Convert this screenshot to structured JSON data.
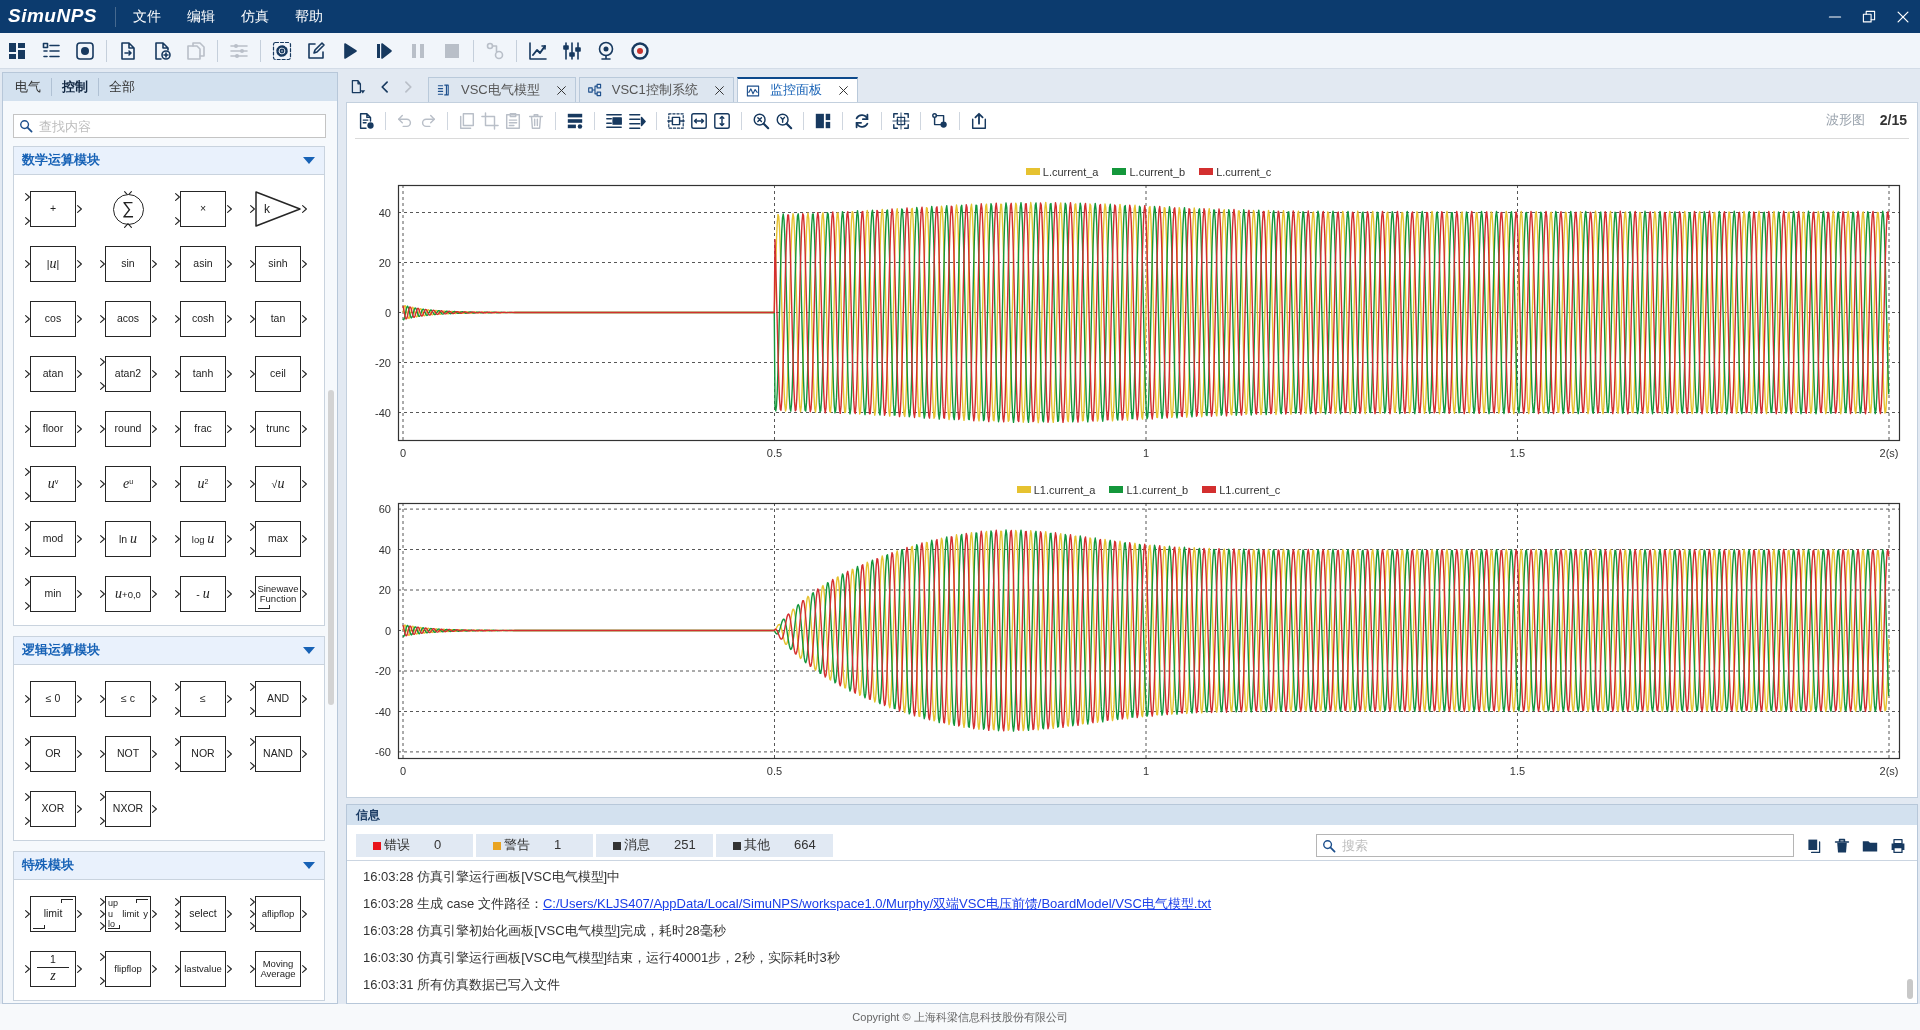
{
  "window": {
    "logo": "SimuNPS",
    "menu": [
      "文件",
      "编辑",
      "仿真",
      "帮助"
    ]
  },
  "toolbar": [
    [
      {
        "kind": "grid",
        "disabled": false
      },
      {
        "kind": "list",
        "disabled": false
      },
      {
        "kind": "screen",
        "disabled": false
      }
    ],
    [
      {
        "kind": "import",
        "disabled": false
      },
      {
        "kind": "add",
        "disabled": false
      },
      {
        "kind": "duplicate",
        "disabled": true
      }
    ],
    [
      {
        "kind": "tune",
        "disabled": true
      }
    ],
    [
      {
        "kind": "gear",
        "disabled": false
      },
      {
        "kind": "edit",
        "disabled": false
      },
      {
        "kind": "play",
        "disabled": false
      },
      {
        "kind": "step",
        "disabled": false
      },
      {
        "kind": "pause",
        "disabled": true
      },
      {
        "kind": "stop",
        "disabled": true
      }
    ],
    [
      {
        "kind": "node",
        "disabled": true
      }
    ],
    [
      {
        "kind": "chart",
        "disabled": false
      },
      {
        "kind": "sliders",
        "disabled": false
      },
      {
        "kind": "pin",
        "disabled": false
      },
      {
        "kind": "target",
        "disabled": false
      }
    ]
  ],
  "library": {
    "tabs": [
      {
        "label": "电气",
        "selected": false
      },
      {
        "label": "控制",
        "selected": true
      },
      {
        "label": "全部",
        "selected": false
      }
    ],
    "search": {
      "placeholder": "查找内容"
    },
    "sections": [
      {
        "title": "数学运算模块",
        "expanded": true,
        "blocks": [
          {
            "label": "+",
            "kind": "binary"
          },
          {
            "label": "∑",
            "kind": "sum"
          },
          {
            "label": "×",
            "kind": "binary"
          },
          {
            "label": "k",
            "kind": "gain"
          },
          {
            "label": "|*u*|",
            "kind": "unary"
          },
          {
            "label": "sin",
            "kind": "unary"
          },
          {
            "label": "asin",
            "kind": "unary"
          },
          {
            "label": "sinh",
            "kind": "unary"
          },
          {
            "label": "cos",
            "kind": "unary"
          },
          {
            "label": "acos",
            "kind": "unary"
          },
          {
            "label": "cosh",
            "kind": "unary"
          },
          {
            "label": "tan",
            "kind": "unary"
          },
          {
            "label": "atan",
            "kind": "unary"
          },
          {
            "label": "atan2",
            "kind": "binary"
          },
          {
            "label": "tanh",
            "kind": "unary"
          },
          {
            "label": "ceil",
            "kind": "unary"
          },
          {
            "label": "floor",
            "kind": "unary"
          },
          {
            "label": "round",
            "kind": "unary"
          },
          {
            "label": "frac",
            "kind": "unary"
          },
          {
            "label": "trunc",
            "kind": "unary"
          },
          {
            "label": "*u*$^{v}$",
            "kind": "binary"
          },
          {
            "label": "*e*$^{u}$",
            "kind": "unary"
          },
          {
            "label": "*u*$^{2}$",
            "kind": "unary"
          },
          {
            "label": "√*u*",
            "kind": "unary"
          },
          {
            "label": "mod",
            "kind": "binary"
          },
          {
            "label": "ln *u*",
            "kind": "unary"
          },
          {
            "label": "log *u*",
            "kind": "unary"
          },
          {
            "label": "max",
            "kind": "binary"
          },
          {
            "label": "min",
            "kind": "binary"
          },
          {
            "label": "*u*+0,0",
            "kind": "unary"
          },
          {
            "label": "- *u*",
            "kind": "unary"
          },
          {
            "label": "Sinewave Function",
            "kind": "wave"
          }
        ]
      },
      {
        "title": "逻辑运算模块",
        "expanded": true,
        "blocks": [
          {
            "label": "≤ 0",
            "kind": "unary"
          },
          {
            "label": "≤ c",
            "kind": "unary"
          },
          {
            "label": "≤",
            "kind": "binary"
          },
          {
            "label": "AND",
            "kind": "binary"
          },
          {
            "label": "OR",
            "kind": "binary"
          },
          {
            "label": "NOT",
            "kind": "unary"
          },
          {
            "label": "NOR",
            "kind": "binary"
          },
          {
            "label": "NAND",
            "kind": "binary"
          },
          {
            "label": "XOR",
            "kind": "binary"
          },
          {
            "label": "NXOR",
            "kind": "binary"
          }
        ]
      },
      {
        "title": "特殊模块",
        "expanded": true,
        "blocks": [
          {
            "label": "limit",
            "kind": "limit"
          },
          {
            "label": "limit",
            "kind": "dynlimit",
            "inputs": [
              "up",
              "u",
              "lo"
            ],
            "output": "y"
          },
          {
            "label": "select",
            "kind": "ternary"
          },
          {
            "label": "aflipflop",
            "kind": "ternary"
          },
          {
            "label": "1",
            "kind": "fraction",
            "denominator": "z"
          },
          {
            "label": "flipflop",
            "kind": "binary"
          },
          {
            "label": "lastvalue",
            "kind": "unary"
          },
          {
            "label": "Moving Average",
            "kind": "unary"
          }
        ]
      }
    ]
  },
  "workspace": {
    "nav": [
      {
        "kind": "menu",
        "disabled": false
      },
      {
        "kind": "back",
        "disabled": false
      },
      {
        "kind": "forward",
        "disabled": true
      }
    ],
    "tabs": [
      {
        "label": "VSC电气模型",
        "kind": "model",
        "selected": false
      },
      {
        "label": "VSC1控制系统",
        "kind": "control",
        "selected": false
      },
      {
        "label": "监控面板",
        "kind": "monitor",
        "selected": true
      }
    ],
    "toolbar": [
      [
        {
          "kind": "new_doc",
          "disabled": false
        }
      ],
      [
        {
          "kind": "undo",
          "disabled": true
        },
        {
          "kind": "redo",
          "disabled": true
        }
      ],
      [
        {
          "kind": "copy",
          "disabled": true
        },
        {
          "kind": "crop",
          "disabled": true
        },
        {
          "kind": "paste",
          "disabled": true
        },
        {
          "kind": "trash",
          "disabled": true
        }
      ],
      [
        {
          "kind": "rows",
          "disabled": false
        }
      ],
      [
        {
          "kind": "lines",
          "disabled": false
        },
        {
          "kind": "indent",
          "disabled": false
        }
      ],
      [
        {
          "kind": "select",
          "disabled": false
        },
        {
          "kind": "fit_width",
          "disabled": false
        },
        {
          "kind": "fit_height",
          "disabled": false
        }
      ],
      [
        {
          "kind": "zoom_x",
          "disabled": false
        },
        {
          "kind": "zoom_y",
          "disabled": false
        }
      ],
      [
        {
          "kind": "split",
          "disabled": false
        }
      ],
      [
        {
          "kind": "refresh",
          "disabled": false
        }
      ],
      [
        {
          "kind": "focus",
          "disabled": false
        }
      ],
      [
        {
          "kind": "branch",
          "disabled": false
        }
      ],
      [
        {
          "kind": "export",
          "disabled": false
        }
      ]
    ],
    "view_label": "波形图",
    "page": "2/15",
    "charts": [
      {
        "kind": "step",
        "series": [
          {
            "name": "L.current_a",
            "color": "#e6c230"
          },
          {
            "name": "L.current_b",
            "color": "#14973b"
          },
          {
            "name": "L.current_c",
            "color": "#d32f2f"
          }
        ],
        "y_tick_labels": [
          "40",
          "20",
          "0",
          "-20",
          "-40"
        ],
        "x_tick_labels": [
          "0",
          "0.5",
          "1",
          "1.5",
          "2(s)"
        ]
      },
      {
        "kind": "swell",
        "series": [
          {
            "name": "L1.current_a",
            "color": "#e6c230"
          },
          {
            "name": "L1.current_b",
            "color": "#14973b"
          },
          {
            "name": "L1.current_c",
            "color": "#d32f2f"
          }
        ],
        "y_tick_labels": [
          "60",
          "40",
          "20",
          "0",
          "-20",
          "-40",
          "-60"
        ],
        "x_tick_labels": [
          "0",
          "0.5",
          "1",
          "1.5",
          "2(s)"
        ]
      }
    ]
  },
  "info": {
    "title": "信息",
    "filters": [
      {
        "label": "错误",
        "count": "0",
        "color": "#e8141b"
      },
      {
        "label": "警告",
        "count": "1",
        "color": "#e9a422"
      },
      {
        "label": "消息",
        "count": "251",
        "color": "#333333"
      },
      {
        "label": "其他",
        "count": "664",
        "color": "#333333"
      }
    ],
    "search": {
      "placeholder": "搜索"
    },
    "log": [
      {
        "text": "16:03:28 仿真引擎运行画板[VSC电气模型]中"
      },
      {
        "text": "16:03:28 生成 case 文件路径：",
        "link": "C:/Users/KLJS407/AppData/Local/SimuNPS/workspace1.0/Murphy/双端VSC电压前馈/BoardModel/VSC电气模型.txt"
      },
      {
        "text": "16:03:28 仿真引擎初始化画板[VSC电气模型]完成，耗时28毫秒"
      },
      {
        "text": "16:03:30 仿真引擎运行画板[VSC电气模型]结束，运行40001步，2秒，实际耗时3秒"
      },
      {
        "text": "16:03:31 所有仿真数据已写入文件"
      }
    ]
  },
  "footer": "Copyright © 上海科梁信息科技股份有限公司"
}
